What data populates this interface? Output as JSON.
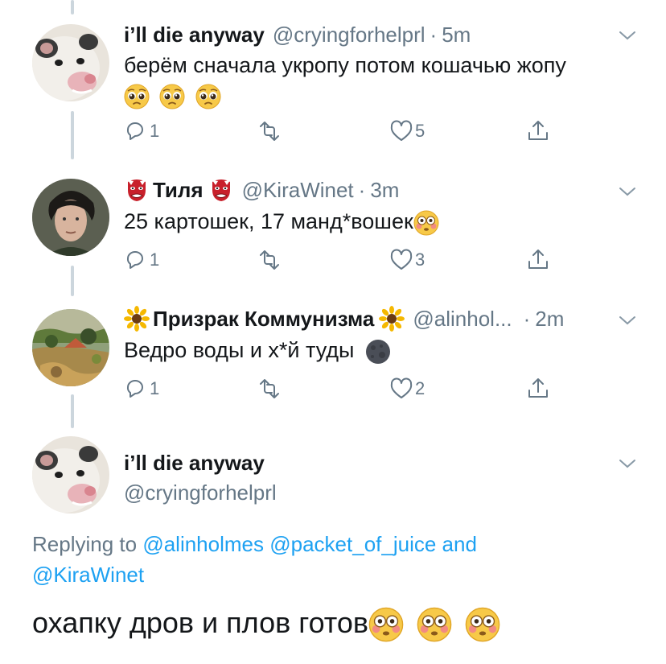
{
  "colors": {
    "accent": "#1da1f2",
    "secondary_text": "#657786",
    "thread_line": "#ccd6dd",
    "text": "#14171a"
  },
  "replies": [
    {
      "author": "i’ll die anyway",
      "handle": "@cryingforhelprl",
      "time": "5m",
      "text": "берём сначала укропу потом кошачью жопу",
      "reply_count": "1",
      "like_count": "5",
      "avatar_icon": "possum-avatar"
    },
    {
      "author": "Тиля",
      "handle": "@KiraWinet",
      "time": "3m",
      "text": "25 картошек, 17 манд*вошек",
      "reply_count": "1",
      "like_count": "3",
      "avatar_icon": "man-portrait-avatar"
    },
    {
      "author": "Призрак Коммунизма",
      "handle": "@alinhol...",
      "time": "2m",
      "text": "Ведро воды и х*й туды",
      "reply_count": "1",
      "like_count": "2",
      "avatar_icon": "painting-avatar"
    }
  ],
  "main_tweet": {
    "author": "i’ll die anyway",
    "handle": "@cryingforhelprl",
    "replying_prefix": "Replying to",
    "mention_1": "@alinholmes",
    "mention_2": "@packet_of_juice",
    "mention_and": "and",
    "mention_3": "@KiraWinet",
    "text": "охапку дров и плов готов"
  }
}
